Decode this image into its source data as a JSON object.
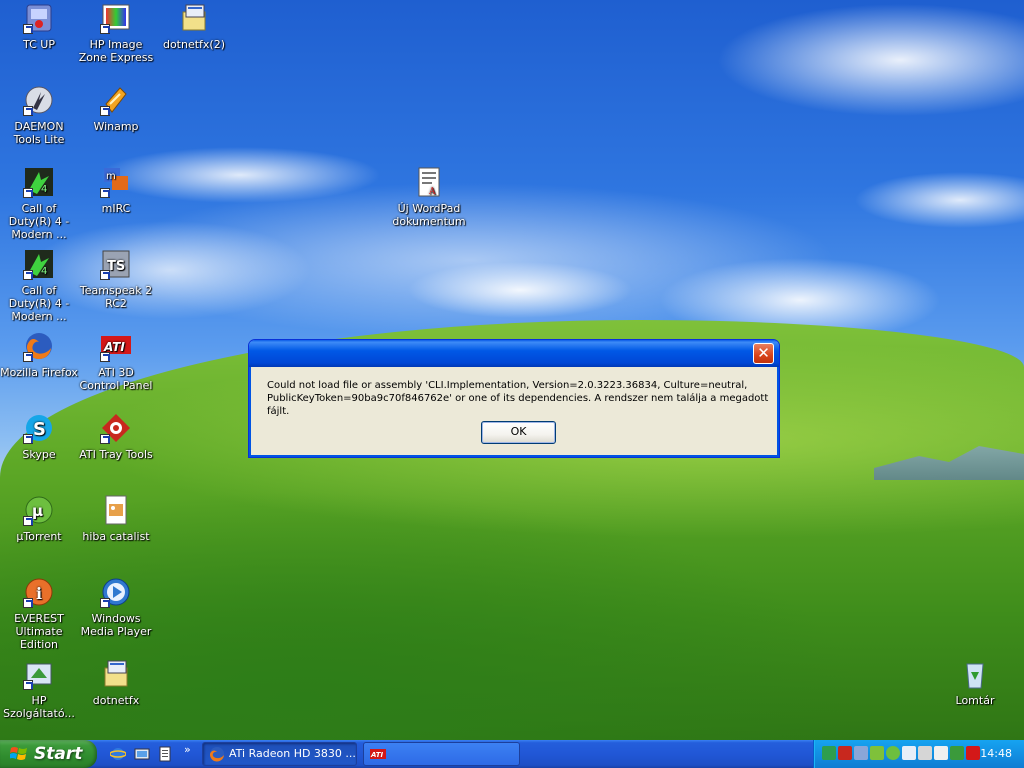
{
  "desktop": {
    "icons": [
      {
        "label": "TC UP",
        "icon": "tc-up-icon"
      },
      {
        "label": "HP Image Zone Express",
        "icon": "hp-image-zone-icon"
      },
      {
        "label": "dotnetfx(2)",
        "icon": "installer-icon"
      },
      {
        "label": "DAEMON Tools Lite",
        "icon": "daemon-tools-icon"
      },
      {
        "label": "Winamp",
        "icon": "winamp-icon"
      },
      {
        "label": "Call of Duty(R) 4 - Modern ...",
        "icon": "cod4-icon"
      },
      {
        "label": "mIRC",
        "icon": "mirc-icon"
      },
      {
        "label": "Új WordPad dokumentum",
        "icon": "wordpad-document-icon"
      },
      {
        "label": "Call of Duty(R) 4 - Modern ...",
        "icon": "cod4-icon"
      },
      {
        "label": "Teamspeak 2 RC2",
        "icon": "teamspeak-icon"
      },
      {
        "label": "Mozilla Firefox",
        "icon": "firefox-icon"
      },
      {
        "label": "ATI 3D Control Panel",
        "icon": "ati-icon"
      },
      {
        "label": "Skype",
        "icon": "skype-icon"
      },
      {
        "label": "ATI Tray Tools",
        "icon": "ati-tray-tools-icon"
      },
      {
        "label": "µTorrent",
        "icon": "utorrent-icon"
      },
      {
        "label": "hiba catalist",
        "icon": "image-file-icon"
      },
      {
        "label": "EVEREST Ultimate Edition",
        "icon": "everest-icon"
      },
      {
        "label": "Windows Media Player",
        "icon": "media-player-icon"
      },
      {
        "label": "HP Szolgáltató...",
        "icon": "hp-service-icon"
      },
      {
        "label": "dotnetfx",
        "icon": "installer-icon"
      },
      {
        "label": "Lomtár",
        "icon": "recycle-bin-icon"
      }
    ]
  },
  "dialog": {
    "message_line1": "Could not load file or assembly 'CLI.Implementation, Version=2.0.3223.36834, Culture=neutral,",
    "message_line2": "PublicKeyToken=90ba9c70f846762e' or one of its dependencies. A rendszer nem találja a megadott fájlt.",
    "ok_label": "OK",
    "close_glyph": "✕"
  },
  "taskbar": {
    "start_label": "Start",
    "quicklaunch_more": "»",
    "tasks": [
      {
        "label": "ATi Radeon HD 3830 ...",
        "icon": "firefox-icon",
        "active": true
      },
      {
        "label": "",
        "icon": "ati-icon",
        "active": false
      }
    ],
    "clock": "14:48"
  },
  "colors": {
    "taskbar_blue": "#245edb",
    "start_green": "#3c9a3a",
    "tray_blue": "#1290e3",
    "dialog_face": "#ece9d8",
    "close_red": "#d8431a"
  }
}
